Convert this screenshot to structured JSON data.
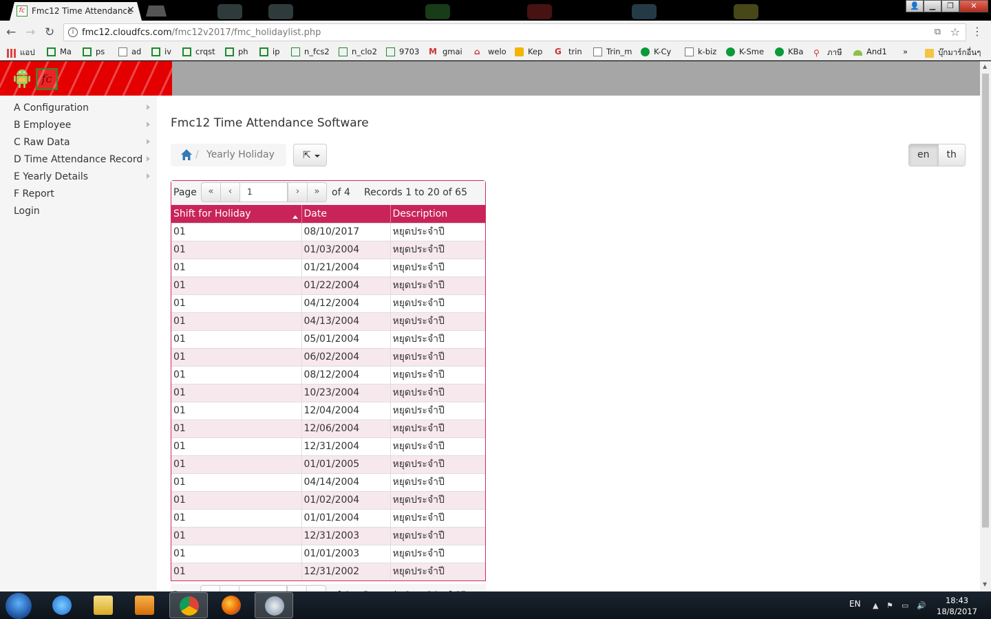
{
  "browser": {
    "tab_title": "Fmc12 Time Attendance",
    "url_host": "fmc12.cloudfcs.com",
    "url_path": "/fmc12v2017/fmc_holidaylist.php",
    "bookmarks": [
      {
        "label": "แอป",
        "icon": "apps-grid-icon"
      },
      {
        "label": "Ma",
        "icon": "sheet-icon"
      },
      {
        "label": "ps",
        "icon": "sheet-icon"
      },
      {
        "label": "ad",
        "icon": "doc-icon"
      },
      {
        "label": "iv",
        "icon": "sheet-icon"
      },
      {
        "label": "crqst",
        "icon": "sheet-icon"
      },
      {
        "label": "ph",
        "icon": "sheet-icon"
      },
      {
        "label": "ip",
        "icon": "sheet-icon"
      },
      {
        "label": "n_fcs2",
        "icon": "fc-icon"
      },
      {
        "label": "n_clo2",
        "icon": "fc-icon"
      },
      {
        "label": "9703",
        "icon": "fc-icon"
      },
      {
        "label": "gmai",
        "icon": "gmail-icon"
      },
      {
        "label": "welo",
        "icon": "welo-icon"
      },
      {
        "label": "Kep",
        "icon": "keep-icon"
      },
      {
        "label": "trin",
        "icon": "google-icon"
      },
      {
        "label": "Trin_m",
        "icon": "doc-icon"
      },
      {
        "label": "K-Cy",
        "icon": "kbank-icon"
      },
      {
        "label": "k-biz",
        "icon": "doc-icon"
      },
      {
        "label": "K-Sme",
        "icon": "kbank-icon"
      },
      {
        "label": "KBa",
        "icon": "kbank-icon"
      },
      {
        "label": "ภาษี",
        "icon": "tax-icon"
      },
      {
        "label": "And1",
        "icon": "android-icon"
      }
    ],
    "bookmarks_overflow": "»",
    "bookmarks_folder": "บุ๊กมาร์กอื่นๆ"
  },
  "sidebar": {
    "items": [
      {
        "label": "A Configuration",
        "has_submenu": true
      },
      {
        "label": "B Employee",
        "has_submenu": true
      },
      {
        "label": "C Raw Data",
        "has_submenu": true
      },
      {
        "label": "D Time Attendance Record",
        "has_submenu": true
      },
      {
        "label": "E Yearly Details",
        "has_submenu": true
      },
      {
        "label": "F Report",
        "has_submenu": false
      },
      {
        "label": "Login",
        "has_submenu": false
      }
    ]
  },
  "main": {
    "title": "Fmc12 Time Attendance Software",
    "breadcrumb": "Yearly Holiday",
    "languages": [
      "en",
      "th"
    ],
    "active_language": "en"
  },
  "pager": {
    "page_label": "Page",
    "current_page": "1",
    "of_label": "of 4",
    "records_label": "Records 1 to 20 of 65"
  },
  "table": {
    "columns": [
      "Shift for Holiday",
      "Date",
      "Description"
    ],
    "sorted_column": "Shift for Holiday",
    "sort_direction": "asc",
    "rows": [
      [
        "01",
        "08/10/2017",
        "หยุดประจำปี"
      ],
      [
        "01",
        "01/03/2004",
        "หยุดประจำปี"
      ],
      [
        "01",
        "01/21/2004",
        "หยุดประจำปี"
      ],
      [
        "01",
        "01/22/2004",
        "หยุดประจำปี"
      ],
      [
        "01",
        "04/12/2004",
        "หยุดประจำปี"
      ],
      [
        "01",
        "04/13/2004",
        "หยุดประจำปี"
      ],
      [
        "01",
        "05/01/2004",
        "หยุดประจำปี"
      ],
      [
        "01",
        "06/02/2004",
        "หยุดประจำปี"
      ],
      [
        "01",
        "08/12/2004",
        "หยุดประจำปี"
      ],
      [
        "01",
        "10/23/2004",
        "หยุดประจำปี"
      ],
      [
        "01",
        "12/04/2004",
        "หยุดประจำปี"
      ],
      [
        "01",
        "12/06/2004",
        "หยุดประจำปี"
      ],
      [
        "01",
        "12/31/2004",
        "หยุดประจำปี"
      ],
      [
        "01",
        "01/01/2005",
        "หยุดประจำปี"
      ],
      [
        "01",
        "04/14/2004",
        "หยุดประจำปี"
      ],
      [
        "01",
        "01/02/2004",
        "หยุดประจำปี"
      ],
      [
        "01",
        "01/01/2004",
        "หยุดประจำปี"
      ],
      [
        "01",
        "12/31/2003",
        "หยุดประจำปี"
      ],
      [
        "01",
        "01/01/2003",
        "หยุดประจำปี"
      ],
      [
        "01",
        "12/31/2002",
        "หยุดประจำปี"
      ]
    ]
  },
  "taskbar": {
    "apps": [
      "start-orb",
      "internet-explorer",
      "file-explorer",
      "media-player",
      "chrome",
      "firefox",
      "paint"
    ],
    "active_app": "chrome",
    "input_language": "EN",
    "time": "18:43",
    "date": "18/8/2017"
  },
  "colors": {
    "brand_red": "#e40000",
    "grid_header": "#c9245a",
    "row_alt": "#f7e8ee",
    "header_gray": "#a6a6a6"
  }
}
